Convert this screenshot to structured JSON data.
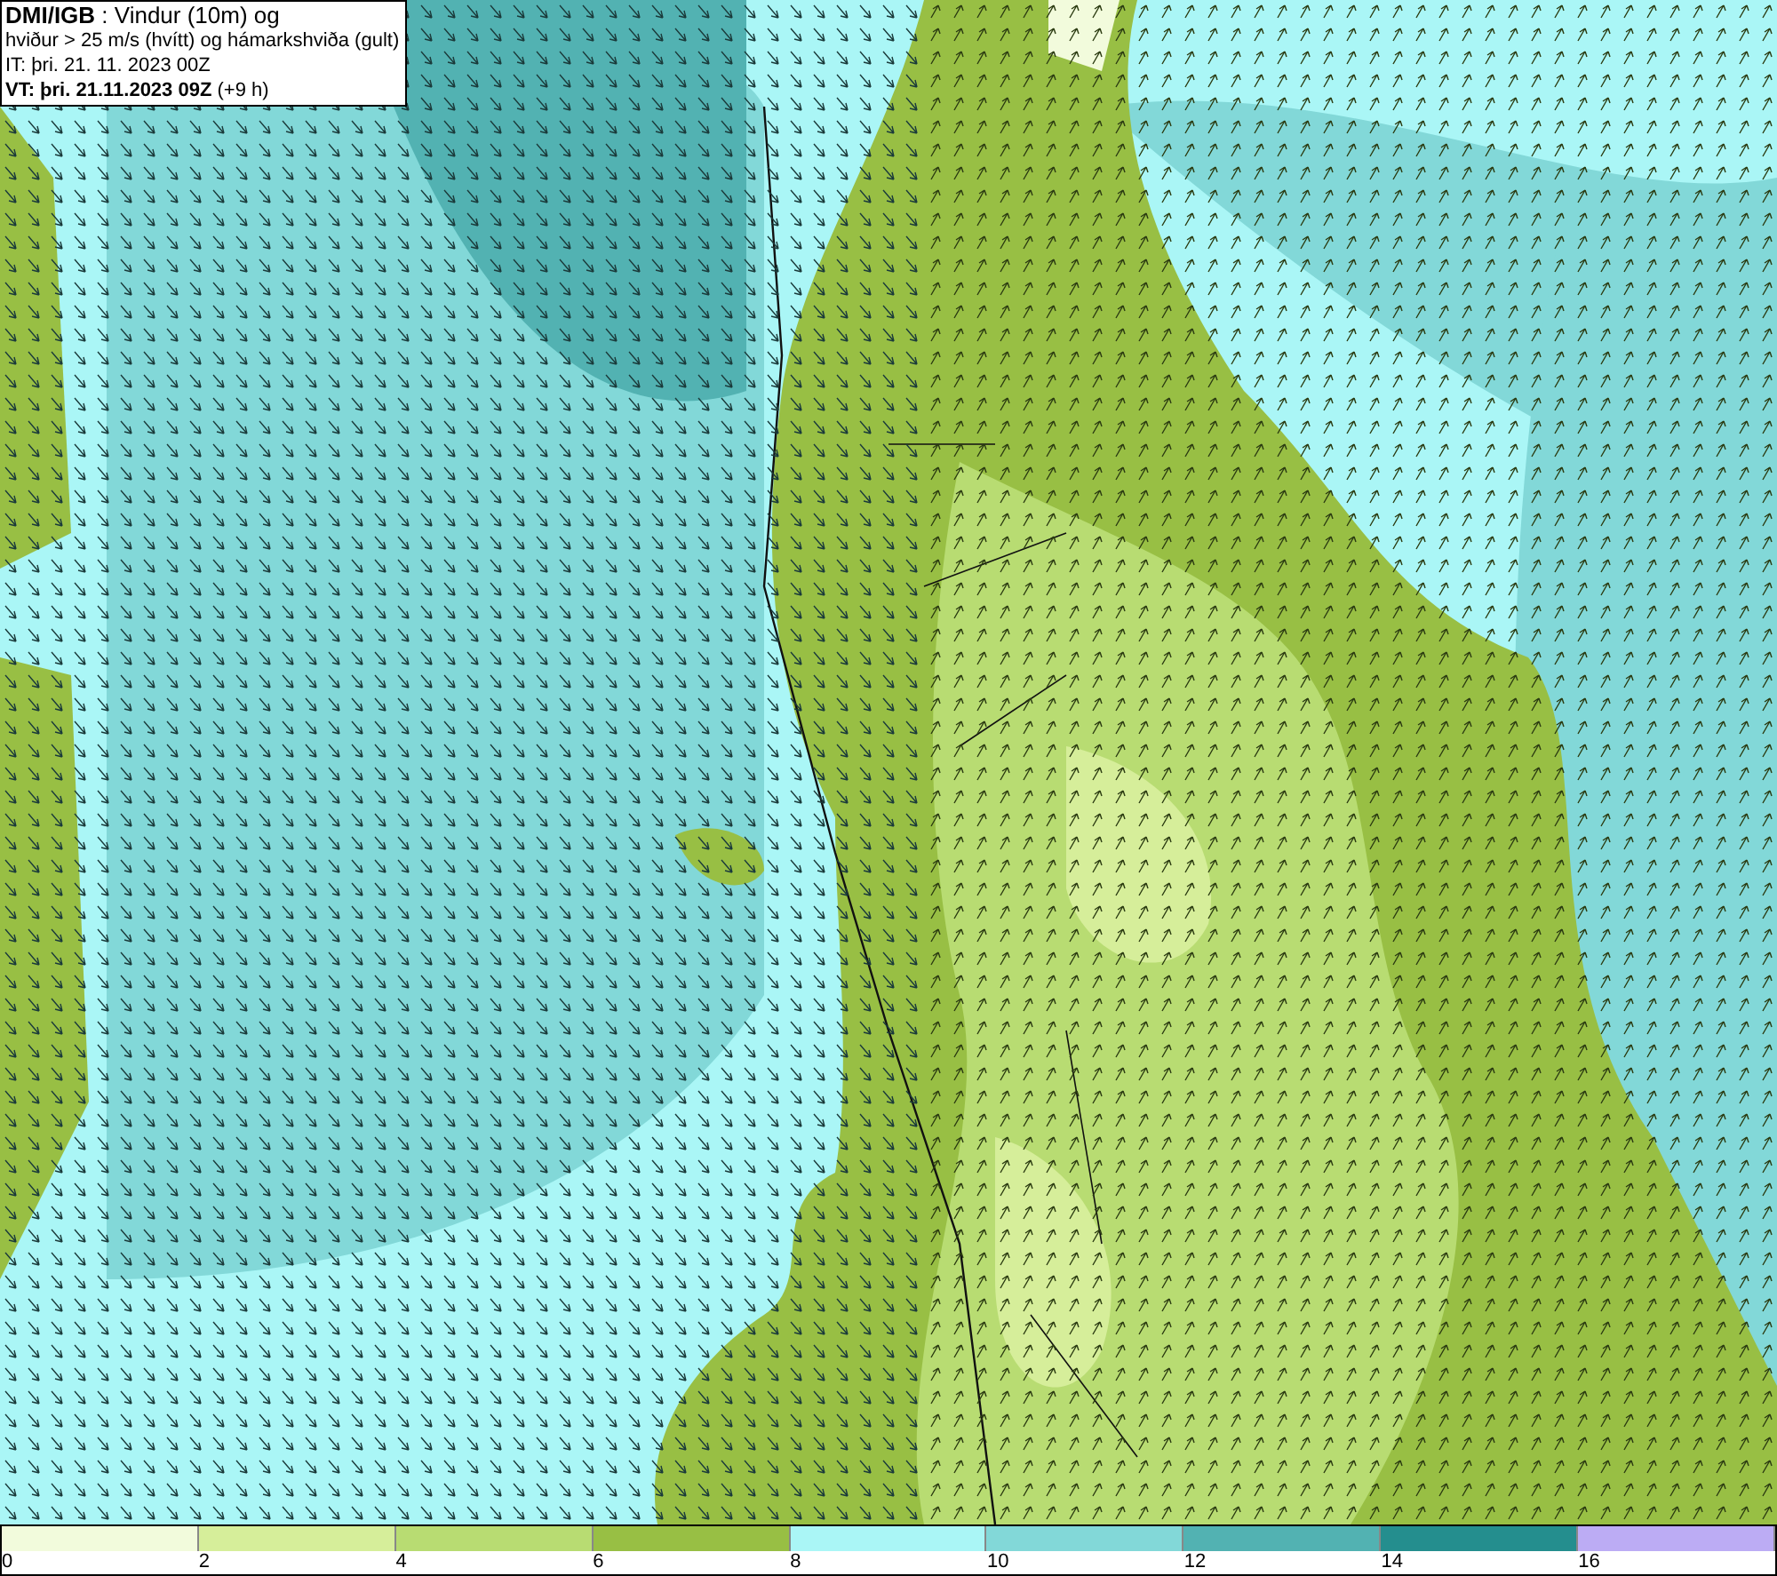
{
  "info_box": {
    "lines": [
      "**DMI/IGB** : Vindur (10m) og",
      "hviður > 25 m/s (hvítt) og hámarkshviða (gult)",
      "IT: þri. 21. 11. 2023 00Z",
      "**VT: þri. 21.11.2023 09Z** (+9 h)"
    ]
  },
  "legend": {
    "items": [
      {
        "color": "#f2fbdc",
        "label": "0"
      },
      {
        "color": "#d6ee9a",
        "label": "2"
      },
      {
        "color": "#b8dc72",
        "label": "4"
      },
      {
        "color": "#98bf44",
        "label": "6"
      },
      {
        "color": "#aaf6f6",
        "label": "8"
      },
      {
        "color": "#82d8d8",
        "label": "10"
      },
      {
        "color": "#52b2b2",
        "label": "12"
      },
      {
        "color": "#248e8e",
        "label": "14"
      },
      {
        "color": "#bcacf4",
        "label": "16"
      }
    ]
  }
}
